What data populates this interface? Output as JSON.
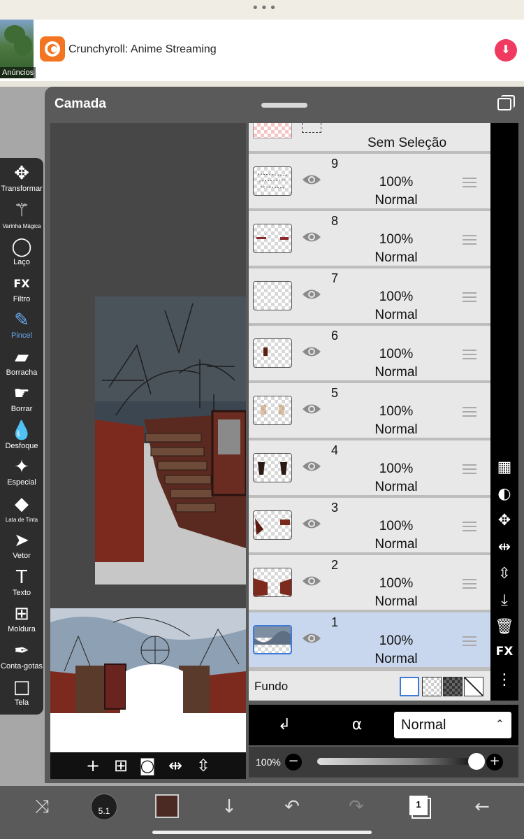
{
  "ad": {
    "menu_dots": "•••",
    "tag": "Anúncios",
    "title": "Crunchyroll: Anime Streaming",
    "download_icon": "download-icon"
  },
  "dialog": {
    "title": "Camada"
  },
  "tools": [
    {
      "label": "Transformar",
      "icon": "move-arrows-icon",
      "glyph": "✥"
    },
    {
      "label": "Varinha Mágica",
      "icon": "magic-wand-icon",
      "glyph": "⚚"
    },
    {
      "label": "Laço",
      "icon": "lasso-icon",
      "glyph": "◯"
    },
    {
      "label": "Filtro",
      "icon": "fx-icon",
      "glyph": "FX"
    },
    {
      "label": "Pincel",
      "icon": "brush-icon",
      "glyph": "✎",
      "active": true
    },
    {
      "label": "Borracha",
      "icon": "eraser-icon",
      "glyph": "▰"
    },
    {
      "label": "Borrar",
      "icon": "smudge-icon",
      "glyph": "☛"
    },
    {
      "label": "Desfoque",
      "icon": "blur-drop-icon",
      "glyph": "💧"
    },
    {
      "label": "Especial",
      "icon": "special-icon",
      "glyph": "✦"
    },
    {
      "label": "Lata de Tinta",
      "icon": "paint-bucket-icon",
      "glyph": "◆"
    },
    {
      "label": "Vetor",
      "icon": "vector-arrow-icon",
      "glyph": "➤"
    },
    {
      "label": "Texto",
      "icon": "text-icon",
      "glyph": "T"
    },
    {
      "label": "Moldura",
      "icon": "frame-icon",
      "glyph": "⊞"
    },
    {
      "label": "Conta-gotas",
      "icon": "eyedropper-icon",
      "glyph": "✒"
    },
    {
      "label": "Tela",
      "icon": "canvas-icon",
      "glyph": "□"
    }
  ],
  "layers": {
    "selection_label": "Sem Seleção",
    "items": [
      {
        "number": "9",
        "opacity": "100%",
        "mode": "Normal"
      },
      {
        "number": "8",
        "opacity": "100%",
        "mode": "Normal"
      },
      {
        "number": "7",
        "opacity": "100%",
        "mode": "Normal"
      },
      {
        "number": "6",
        "opacity": "100%",
        "mode": "Normal"
      },
      {
        "number": "5",
        "opacity": "100%",
        "mode": "Normal"
      },
      {
        "number": "4",
        "opacity": "100%",
        "mode": "Normal"
      },
      {
        "number": "3",
        "opacity": "100%",
        "mode": "Normal"
      },
      {
        "number": "2",
        "opacity": "100%",
        "mode": "Normal"
      },
      {
        "number": "1",
        "opacity": "100%",
        "mode": "Normal",
        "selected": true
      }
    ],
    "background_label": "Fundo"
  },
  "side_actions": [
    "checker-icon",
    "circle-half-icon",
    "move-icon",
    "flip-horizontal-icon",
    "flip-vertical-icon",
    "merge-down-icon",
    "trash-icon",
    "fx-icon",
    "more-vert-icon"
  ],
  "side_fx_label": "FX",
  "blend": {
    "mode": "Normal",
    "opacity": "100%",
    "opacity_value": 1.0
  },
  "bottom": {
    "brush_size": "5.1",
    "layer_count": "1",
    "color": "#4a2a22"
  }
}
